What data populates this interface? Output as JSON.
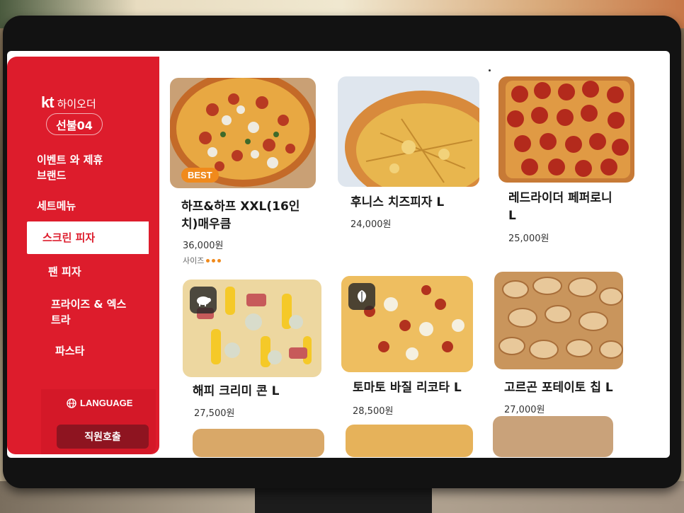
{
  "sidebar": {
    "brand_logo": "kt",
    "brand_app": "하이오더",
    "table": "선불04",
    "items": [
      {
        "label": "이벤트 와 제휴\n브랜드",
        "active": false
      },
      {
        "label": "세트메뉴",
        "active": false
      },
      {
        "label": "스크린 피자",
        "active": true
      },
      {
        "label": "팬 피자",
        "active": false
      },
      {
        "label": "프라이즈 & 엑스\n트라",
        "active": false
      },
      {
        "label": "파스타",
        "active": false
      }
    ],
    "language_label": "LANGUAGE",
    "staff_call_label": "직원호출"
  },
  "menu_items": [
    {
      "name": "하프&하프 XXL(16인\n치)매우큼",
      "price": "36,000원",
      "badge": "BEST",
      "option_label": "사이즈",
      "icon": null
    },
    {
      "name": "후니스 치즈피자 L",
      "price": "24,000원",
      "badge": null,
      "option_label": null,
      "icon": null
    },
    {
      "name": "레드라이더 페퍼로니\nL",
      "price": "25,000원",
      "badge": null,
      "option_label": null,
      "icon": null
    },
    {
      "name": "해피 크리미 콘 L",
      "price": "27,500원",
      "badge": null,
      "option_label": null,
      "icon": "pig-icon"
    },
    {
      "name": "토마토 바질 리코타 L",
      "price": "28,500원",
      "badge": null,
      "option_label": null,
      "icon": "leaf-icon"
    },
    {
      "name": "고르곤 포테이토 칩 L",
      "price": "27,000원",
      "badge": null,
      "option_label": null,
      "icon": null
    }
  ],
  "colors": {
    "accent": "#dd1c2c",
    "badge": "#f08a1c",
    "staff_button": "#8e1420"
  }
}
